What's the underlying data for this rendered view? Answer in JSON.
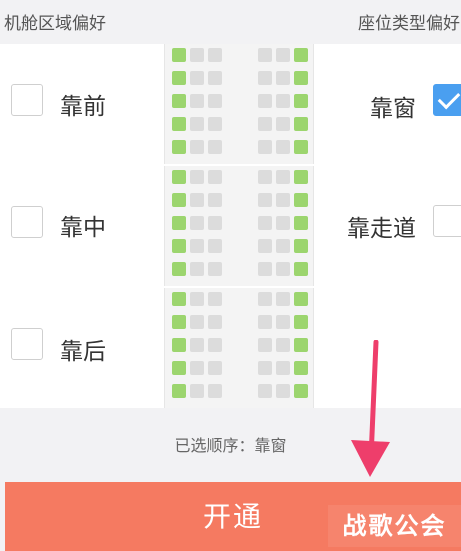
{
  "header": {
    "cabin_zone_title": "机舱区域偏好",
    "seat_type_title": "座位类型偏好"
  },
  "cabin_options": [
    {
      "label": "靠前",
      "checked": false
    },
    {
      "label": "靠中",
      "checked": false
    },
    {
      "label": "靠后",
      "checked": false
    }
  ],
  "seat_type_options": [
    {
      "label": "靠窗",
      "checked": true
    },
    {
      "label": "靠走道",
      "checked": false
    }
  ],
  "summary": {
    "label": "已选顺序：",
    "value": "靠窗"
  },
  "confirm_button": {
    "label": "开通"
  },
  "watermark": {
    "text": "战歌公会"
  },
  "colors": {
    "window_seat": "#9cd56e",
    "other_seat": "#dcdcdc",
    "checkbox_checked": "#4a9ff0",
    "button": "#f57a61",
    "arrow": "#ee3e6b"
  },
  "seat_map": {
    "sections": 3,
    "rows_per_section": 5,
    "columns": [
      "window",
      "middle",
      "aisle",
      "aisle",
      "middle",
      "window"
    ]
  }
}
